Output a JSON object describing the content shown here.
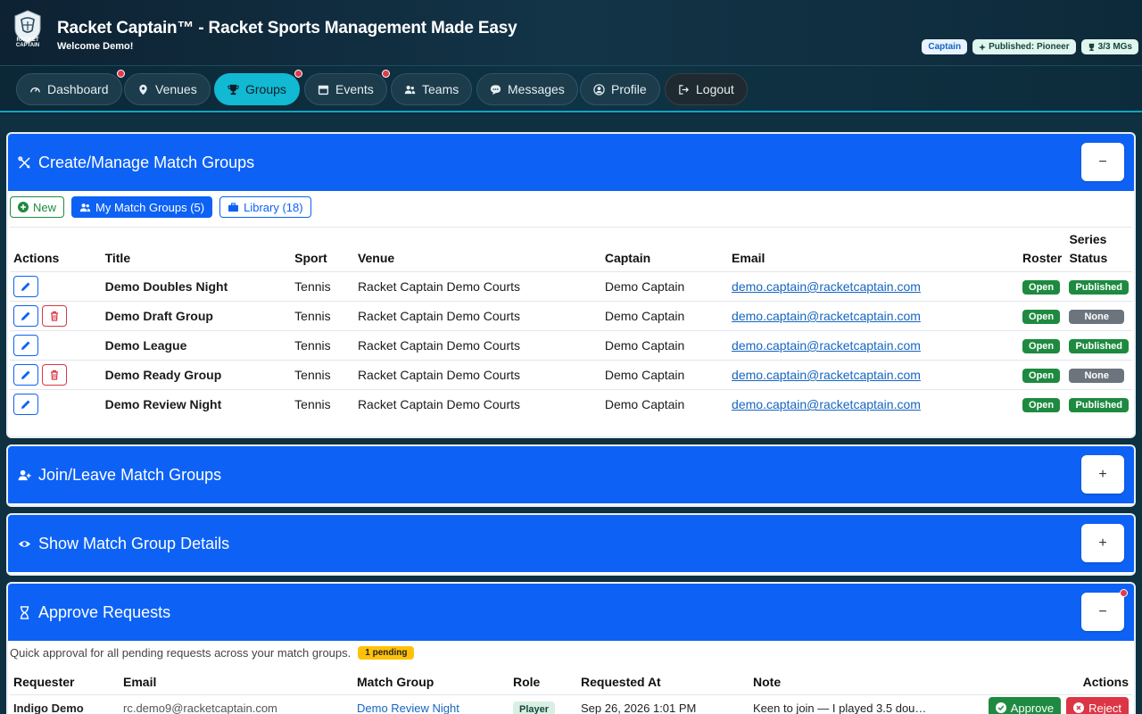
{
  "header": {
    "logo_text": "RACKET CAPTAIN",
    "title": "Racket Captain™ - Racket Sports Management Made Easy",
    "welcome": "Welcome Demo!",
    "badges": {
      "captain": "Captain",
      "published": "Published: Pioneer",
      "mgs": "3/3 MGs"
    }
  },
  "nav": {
    "dashboard": "Dashboard",
    "venues": "Venues",
    "groups": "Groups",
    "events": "Events",
    "teams": "Teams",
    "messages": "Messages",
    "profile": "Profile",
    "logout": "Logout"
  },
  "manage": {
    "title": "Create/Manage Match Groups",
    "toggle": "−",
    "tabs": {
      "new": "New",
      "my": "My Match Groups (5)",
      "library": "Library (18)"
    },
    "columns": {
      "actions": "Actions",
      "title": "Title",
      "sport": "Sport",
      "venue": "Venue",
      "captain": "Captain",
      "email": "Email",
      "roster": "Roster",
      "series_status_1": "Series",
      "series_status_2": "Status"
    },
    "rows": [
      {
        "title": "Demo Doubles Night",
        "sport": "Tennis",
        "venue": "Racket Captain Demo Courts",
        "captain": "Demo Captain",
        "email": "demo.captain@racketcaptain.com",
        "roster": "Open",
        "status": "Published"
      },
      {
        "title": "Demo Draft Group",
        "sport": "Tennis",
        "venue": "Racket Captain Demo Courts",
        "captain": "Demo Captain",
        "email": "demo.captain@racketcaptain.com",
        "roster": "Open",
        "status": "None"
      },
      {
        "title": "Demo League",
        "sport": "Tennis",
        "venue": "Racket Captain Demo Courts",
        "captain": "Demo Captain",
        "email": "demo.captain@racketcaptain.com",
        "roster": "Open",
        "status": "Published"
      },
      {
        "title": "Demo Ready Group",
        "sport": "Tennis",
        "venue": "Racket Captain Demo Courts",
        "captain": "Demo Captain",
        "email": "demo.captain@racketcaptain.com",
        "roster": "Open",
        "status": "None"
      },
      {
        "title": "Demo Review Night",
        "sport": "Tennis",
        "venue": "Racket Captain Demo Courts",
        "captain": "Demo Captain",
        "email": "demo.captain@racketcaptain.com",
        "roster": "Open",
        "status": "Published"
      }
    ]
  },
  "join": {
    "title": "Join/Leave Match Groups",
    "toggle": "+"
  },
  "details": {
    "title": "Show Match Group Details",
    "toggle": "+"
  },
  "approve": {
    "title": "Approve Requests",
    "toggle": "−",
    "subtitle": "Quick approval for all pending requests across your match groups.",
    "pending": "1 pending",
    "columns": {
      "requester": "Requester",
      "email": "Email",
      "group": "Match Group",
      "role": "Role",
      "requested_at": "Requested At",
      "note": "Note",
      "actions": "Actions"
    },
    "rows": [
      {
        "requester": "Indigo Demo",
        "email": "rc.demo9@racketcaptain.com",
        "group": "Demo Review Night",
        "role": "Player",
        "requested_at": "Sep 26, 2026 1:01 PM",
        "note": "Keen to join — I played 3.5 dou…",
        "approve": "Approve",
        "reject": "Reject"
      }
    ]
  },
  "colors": {
    "primary": "#0d62f5",
    "accent": "#12b9d3",
    "success": "#1e8a40",
    "danger": "#dc3545",
    "warning": "#ffc107"
  }
}
